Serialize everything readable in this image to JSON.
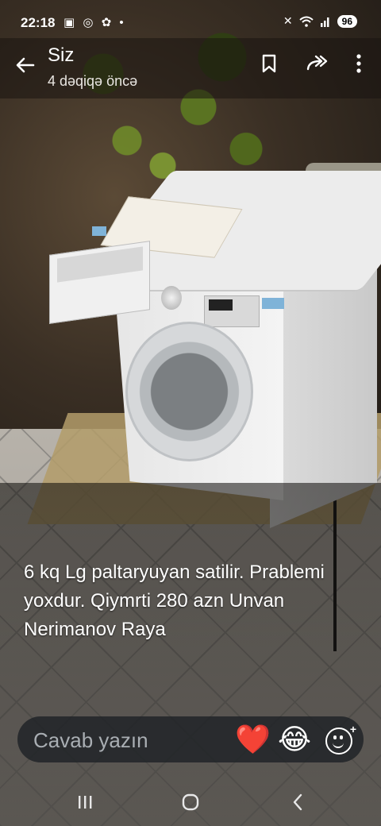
{
  "status_bar": {
    "time": "22:18",
    "left_icons": [
      "screenshot-icon",
      "whatsapp-icon",
      "paw-icon",
      "dot-icon"
    ],
    "right_icons": [
      "mute-icon",
      "wifi-icon",
      "signal-icon"
    ],
    "battery": "96"
  },
  "header": {
    "title": "Siz",
    "subtitle": "4 dəqiqə öncə",
    "actions": [
      "bookmark-icon",
      "forward-icon",
      "more-icon"
    ]
  },
  "status": {
    "caption": "6 kq Lg paltaryuyan  satilir. Prablemi yoxdur. Qiymrti 280 azn Unvan Nerimanov Raya"
  },
  "reply": {
    "placeholder": "Cavab yazın",
    "quick_reactions": [
      "❤️",
      "😂"
    ]
  },
  "navigation": {
    "buttons": [
      "recents-icon",
      "home-icon",
      "back-icon"
    ]
  },
  "colors": {
    "overlay": "#19140f",
    "reply_bar": "#1e2226",
    "text": "#ffffff"
  }
}
